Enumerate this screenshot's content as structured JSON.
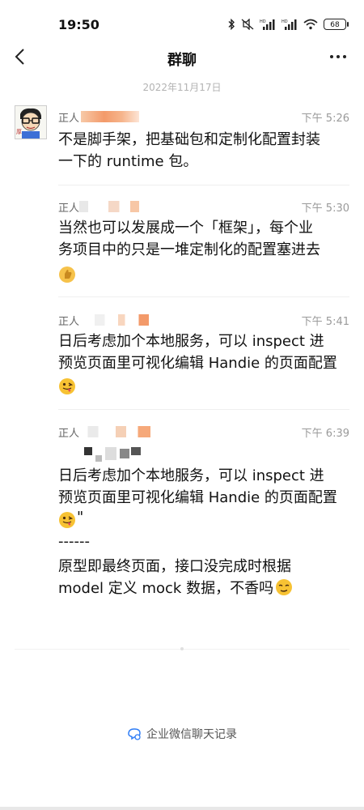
{
  "status_bar": {
    "time": "19:50",
    "battery": "68",
    "icons": [
      "bluetooth-icon",
      "mute-icon",
      "signal-hd-icon",
      "signal-hd-icon",
      "wifi-icon",
      "battery-icon"
    ]
  },
  "header": {
    "title": "群聊",
    "back_icon": "chevron-left-icon",
    "more_icon": "more-horizontal-icon"
  },
  "date_divider": "2022年11月17日",
  "messages": [
    {
      "sender": "正人",
      "time": "下午 5:26",
      "text": "不是脚手架，把基础包和定制化配置封装\n一下的 runtime 包。"
    },
    {
      "sender": "正人",
      "time": "下午 5:30",
      "text": "当然也可以发展成一个「框架」，每个业\n务项目中的只是一堆定制化的配置塞进去",
      "emoji": "thumbs-up-emoji"
    },
    {
      "sender": "正人",
      "time": "下午 5:41",
      "text": "日后考虑加个本地服务，可以 inspect 进\n预览页面里可视化编辑 Handie 的页面配置",
      "emoji": "wink-tongue-emoji"
    },
    {
      "sender": "正人",
      "time": "下午 6:39",
      "quote_text": "日后考虑加个本地服务，可以 inspect 进\n预览页面里可视化编辑 Handie 的页面配置",
      "quote_end": "\"",
      "divider": "------",
      "text": "原型即最终页面，接口没完成时根据\nmodel 定义 mock 数据，不香吗",
      "emoji": "wink-tongue-emoji",
      "end_emoji": "smirk-emoji"
    }
  ],
  "footer": {
    "label": "企业微信聊天记录",
    "icon": "chat-bubbles-icon",
    "accent": "#2f7df6"
  }
}
